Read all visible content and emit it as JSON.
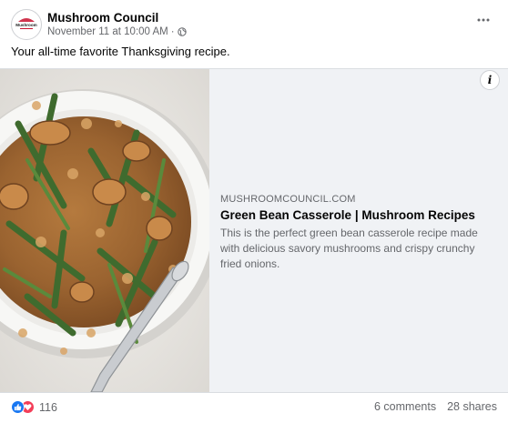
{
  "post": {
    "page_name": "Mushroom Council",
    "timestamp": "November 11 at 10:00 AM",
    "separator": "·",
    "audience_icon": "globe-icon",
    "text": "Your all-time favorite Thanksgiving recipe.",
    "avatar_logo_text": "Mushroom"
  },
  "link_card": {
    "image_icon": "green-bean-casserole-photo",
    "domain": "MUSHROOMCOUNCIL.COM",
    "title": "Green Bean Casserole | Mushroom Recipes",
    "description": "This is the perfect green bean casserole recipe made with delicious savory mushrooms and crispy crunchy fried onions.",
    "info_glyph": "i"
  },
  "footer": {
    "reaction_icons": [
      "like-icon",
      "love-icon"
    ],
    "reaction_count": "116",
    "comments": "6 comments",
    "shares": "28 shares"
  },
  "colors": {
    "like": "#1877f2",
    "love": "#f33e58",
    "secondary_text": "#65676b",
    "card_background": "#f0f2f5"
  }
}
